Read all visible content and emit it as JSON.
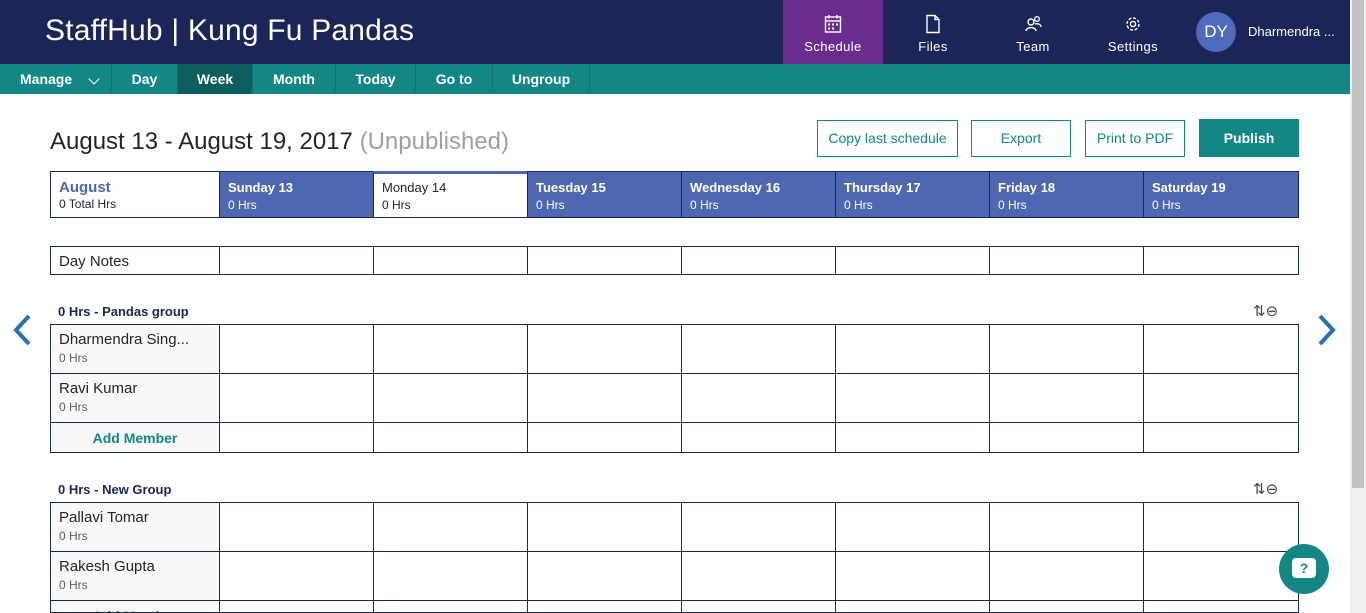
{
  "header": {
    "app_title": "StaffHub | Kung Fu Pandas",
    "nav": [
      {
        "label": "Schedule",
        "icon": "calendar-icon",
        "active": true
      },
      {
        "label": "Files",
        "icon": "file-icon"
      },
      {
        "label": "Team",
        "icon": "team-icon"
      },
      {
        "label": "Settings",
        "icon": "gear-icon"
      }
    ],
    "avatar_initials": "DY",
    "username": "Dharmendra ..."
  },
  "toolbar": {
    "items": [
      "Manage",
      "Day",
      "Week",
      "Month",
      "Today",
      "Go to",
      "Ungroup"
    ],
    "active": "Week"
  },
  "page": {
    "title": "August 13 - August 19, 2017",
    "status": "(Unpublished)",
    "buttons": {
      "copy": "Copy last schedule",
      "export": "Export",
      "print": "Print to PDF",
      "publish": "Publish"
    }
  },
  "calendar": {
    "month": "August",
    "total": "0 Total Hrs",
    "days": [
      {
        "label": "Sunday 13",
        "hours": "0 Hrs"
      },
      {
        "label": "Monday 14",
        "hours": "0 Hrs",
        "today": true
      },
      {
        "label": "Tuesday 15",
        "hours": "0 Hrs"
      },
      {
        "label": "Wednesday 16",
        "hours": "0 Hrs"
      },
      {
        "label": "Thursday 17",
        "hours": "0 Hrs"
      },
      {
        "label": "Friday 18",
        "hours": "0 Hrs"
      },
      {
        "label": "Saturday 19",
        "hours": "0 Hrs"
      }
    ],
    "day_notes_label": "Day Notes"
  },
  "groups": [
    {
      "title": "0 Hrs - Pandas group",
      "members": [
        {
          "name": "Dharmendra Sing...",
          "hours": "0 Hrs"
        },
        {
          "name": "Ravi Kumar",
          "hours": "0 Hrs"
        }
      ],
      "add_label": "Add Member"
    },
    {
      "title": "0 Hrs - New Group",
      "members": [
        {
          "name": "Pallavi Tomar",
          "hours": "0 Hrs"
        },
        {
          "name": "Rakesh Gupta",
          "hours": "0 Hrs"
        }
      ],
      "add_label": "Add Member"
    }
  ],
  "colors": {
    "header": "#1c2557",
    "toolbar": "#138785",
    "active_nav": "#6b2c8f",
    "day_header": "#4f67b0"
  }
}
